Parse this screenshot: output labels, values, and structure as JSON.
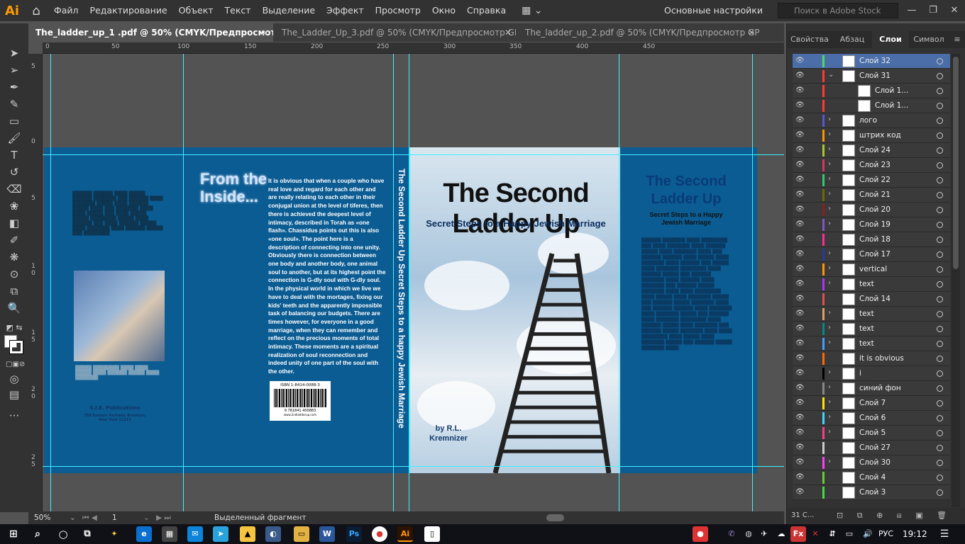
{
  "app": {
    "logo": "Ai",
    "home_icon": "home-icon"
  },
  "menu": [
    "Файл",
    "Редактирование",
    "Объект",
    "Текст",
    "Выделение",
    "Эффект",
    "Просмотр",
    "Окно",
    "Справка"
  ],
  "workspace": {
    "switcher_icon": "workspace-grid-icon",
    "name": "Основные настройки"
  },
  "search": {
    "placeholder": "Поиск в Adobe Stock"
  },
  "window_controls": {
    "minimize": "—",
    "restore": "❐",
    "close": "✕"
  },
  "tabs": [
    {
      "label": "The_ladder_up_1 .pdf @ 50% (CMYK/Предпросмотр GPU)",
      "active": true
    },
    {
      "label": "The_Ladder_Up_3.pdf @ 50% (CMYK/Предпросмотр GP...",
      "active": false
    },
    {
      "label": "The_ladder_up_2.pdf @ 50% (CMYK/Предпросмотр GP...",
      "active": false
    }
  ],
  "ruler": {
    "h": [
      "0",
      "50",
      "100",
      "150",
      "200",
      "250",
      "300",
      "350",
      "400",
      "450"
    ],
    "v": [
      "5",
      "0",
      "5",
      "1",
      "0",
      "1",
      "5",
      "2",
      "0",
      "2",
      "5"
    ]
  },
  "cover": {
    "from_inside": "From the Inside...",
    "body": "It is obvious that when a couple who have real love and regard for each other and are really relating to each other in their conjugal union at the level of tiferes, then there is achieved the deepest level of intimacy, described in Torah as «one flash». Chassidus points out this is also «one soul». The point here is a description of connecting into one unity. Obviously there is connection between one body and another body, one animal soul to another, but at its highest point the connection is G-dly soul with G-dly soul. In the physical world in which we live we have to deal with the mortages, fixing our kids' teeth and the apparently impossible task of balancing our budgets. There are times however, for everyone in a good marriage, when they can remember and reflect on the precious moments of total intimacy. These moments are a spiritual realization of soul reconnection and indeed unity of one part of the soul with the other.",
    "spine_title": "The Second Ladder Up   Secret Steps to a happy Jewish Marriage",
    "front_title": "The Second Ladder Up",
    "front_sub": "Secret Steps to a Happy Jewish Marriage",
    "front_by": "by R.L. Kremnizer",
    "rear_title": "The Second Ladder Up",
    "rear_sub": "Secret Steps to a Happy Jewish Marriage",
    "publisher": "S.I.E. Publications",
    "publisher_addr": "788 Eastern Parkway Brooklyn, New York 11213",
    "isbn": "ISBN 1-8414-0088-3",
    "barcode_num": "9 781841 400883",
    "barcode_site": "www.2ndladderup.com"
  },
  "status": {
    "zoom": "50%",
    "page": "1",
    "selection": "Выделенный фрагмент"
  },
  "panel": {
    "tabs": [
      "Свойства",
      "Абзац",
      "Слои",
      "Символ"
    ],
    "layers": [
      {
        "name": "Слой 32",
        "color": "#4cd964",
        "arrow": "",
        "selected": true
      },
      {
        "name": "Слой 31",
        "color": "#ff3b30",
        "arrow": "⌄",
        "selected": false
      },
      {
        "name": "Слой 1...",
        "color": "#ff3b30",
        "arrow": "",
        "selected": false,
        "indent": true
      },
      {
        "name": "Слой 1...",
        "color": "#ff3b30",
        "arrow": "",
        "selected": false,
        "indent": true
      },
      {
        "name": "лого",
        "color": "#5856d6",
        "arrow": "›",
        "selected": false
      },
      {
        "name": "штрих код",
        "color": "#ff9500",
        "arrow": "›",
        "selected": false
      },
      {
        "name": "Слой 24",
        "color": "#a8c92a",
        "arrow": "›",
        "selected": false
      },
      {
        "name": "Слой 23",
        "color": "#d63864",
        "arrow": "›",
        "selected": false
      },
      {
        "name": "Слой 22",
        "color": "#2ecc71",
        "arrow": "›",
        "selected": false
      },
      {
        "name": "Слой 21",
        "color": "#6b6b00",
        "arrow": "›",
        "selected": false
      },
      {
        "name": "Слой 20",
        "color": "#8e1d1d",
        "arrow": "›",
        "selected": false
      },
      {
        "name": "Слой 19",
        "color": "#7e57c2",
        "arrow": "›",
        "selected": false
      },
      {
        "name": "Слой 18",
        "color": "#ff2d95",
        "arrow": "",
        "selected": false
      },
      {
        "name": "Слой 17",
        "color": "#1f3ea0",
        "arrow": "›",
        "selected": false
      },
      {
        "name": "vertical",
        "color": "#ff9500",
        "arrow": "›",
        "selected": false
      },
      {
        "name": "text",
        "color": "#aa33ff",
        "arrow": "›",
        "selected": false
      },
      {
        "name": "Слой 14",
        "color": "#e05050",
        "arrow": "",
        "selected": false
      },
      {
        "name": "text",
        "color": "#e0a060",
        "arrow": "›",
        "selected": false
      },
      {
        "name": "text",
        "color": "#008a8a",
        "arrow": "›",
        "selected": false
      },
      {
        "name": "text",
        "color": "#40a0ff",
        "arrow": "›",
        "selected": false
      },
      {
        "name": "it is obvious",
        "color": "#ff6a00",
        "arrow": "",
        "selected": false
      },
      {
        "name": "i",
        "color": "#000000",
        "arrow": "›",
        "selected": false
      },
      {
        "name": "синий фон",
        "color": "#888888",
        "arrow": "›",
        "selected": false
      },
      {
        "name": "Слой 7",
        "color": "#ffe600",
        "arrow": "›",
        "selected": false
      },
      {
        "name": "Слой 6",
        "color": "#3fd7ff",
        "arrow": "›",
        "selected": false
      },
      {
        "name": "Слой 5",
        "color": "#ff3b8a",
        "arrow": "›",
        "selected": false
      },
      {
        "name": "Слой 27",
        "color": "#cccccc",
        "arrow": "",
        "selected": false
      },
      {
        "name": "Слой 30",
        "color": "#ff3bff",
        "arrow": "›",
        "selected": false
      },
      {
        "name": "Слой 4",
        "color": "#66cc33",
        "arrow": "",
        "selected": false
      },
      {
        "name": "Слой 3",
        "color": "#44dd44",
        "arrow": "",
        "selected": false
      }
    ],
    "footer": "31 С..."
  },
  "taskbar": {
    "lang": "РУС",
    "time": "19:12"
  }
}
